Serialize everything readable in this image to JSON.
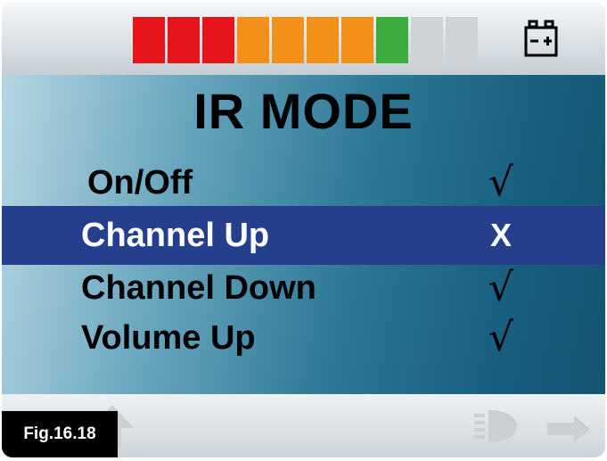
{
  "header": {
    "gauge_level": 7,
    "gauge_total": 9,
    "gauge_colors": [
      "#e8141c",
      "#e8141c",
      "#e8141c",
      "#f39017",
      "#f39017",
      "#f39017",
      "#f39017",
      "#3cad3c",
      "#cfd3d6",
      "#cfd3d6"
    ],
    "battery_icon": "battery-icon"
  },
  "screen": {
    "title": "IR MODE",
    "items": [
      {
        "label": "On/Off",
        "status": "√"
      },
      {
        "label": "Channel Up",
        "status": "X"
      },
      {
        "label": "Channel Down",
        "status": "√"
      },
      {
        "label": "Volume Up",
        "status": "√"
      }
    ]
  },
  "footer": {
    "icons": [
      "left-arrow-icon",
      "up-arrow-icon",
      "lamp-icon",
      "right-arrow-icon"
    ]
  },
  "figure_label": "Fig.16.18"
}
